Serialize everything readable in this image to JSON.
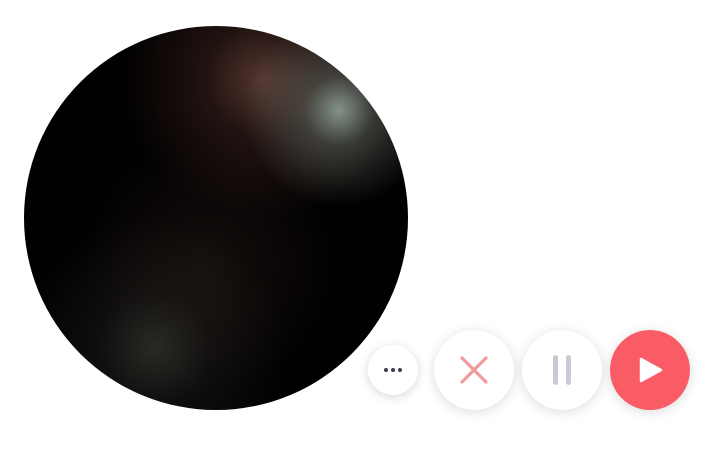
{
  "recorder": {
    "preview": {
      "icon": "camera-preview"
    },
    "controls": {
      "more": {
        "icon": "more-horizontal-icon",
        "color": "#3a3f4a"
      },
      "cancel": {
        "icon": "close-icon",
        "color": "#f19a9e"
      },
      "pause": {
        "icon": "pause-icon",
        "color": "#c7ccd4"
      },
      "record": {
        "icon": "play-icon",
        "background": "#fa5c66",
        "foreground": "#ffffff"
      }
    }
  }
}
